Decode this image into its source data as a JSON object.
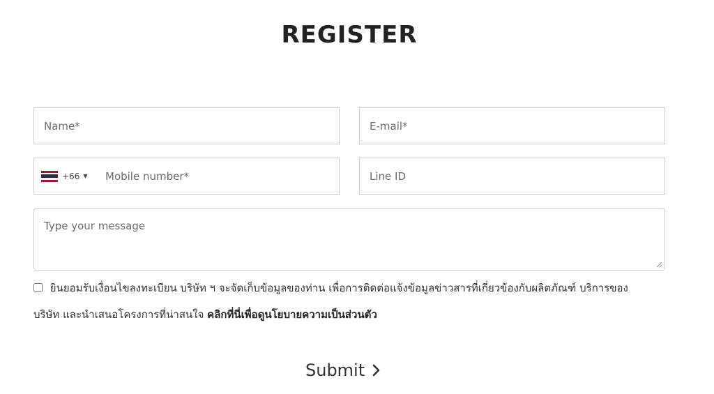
{
  "title": "REGISTER",
  "form": {
    "name_placeholder": "Name*",
    "email_placeholder": "E-mail*",
    "country": {
      "dial_code": "+66",
      "flag": "thailand-flag-icon"
    },
    "mobile_placeholder": "Mobile number*",
    "line_placeholder": "Line ID",
    "message_placeholder": "Type your message"
  },
  "consent": {
    "text": "ยินยอมรับเงื่อนไขลงทะเบียน บริษัท ฯ จะจัดเก็บข้อมูลของท่าน เพื่อการติดต่อแจ้งข้อมูลข่าวสารที่เกี่ยวข้องกับผลิตภัณฑ์ บริการของบริษัท และนำเสนอโครงการที่น่าสนใจ ",
    "link_text": "คลิกที่นี่เพื่อดูนโยบายความเป็นส่วนตัว",
    "checked": false
  },
  "submit": {
    "label": "Submit",
    "icon": "chevron-right-icon"
  },
  "colors": {
    "border": "#cfcfcf",
    "text": "#333333",
    "title": "#222222"
  }
}
